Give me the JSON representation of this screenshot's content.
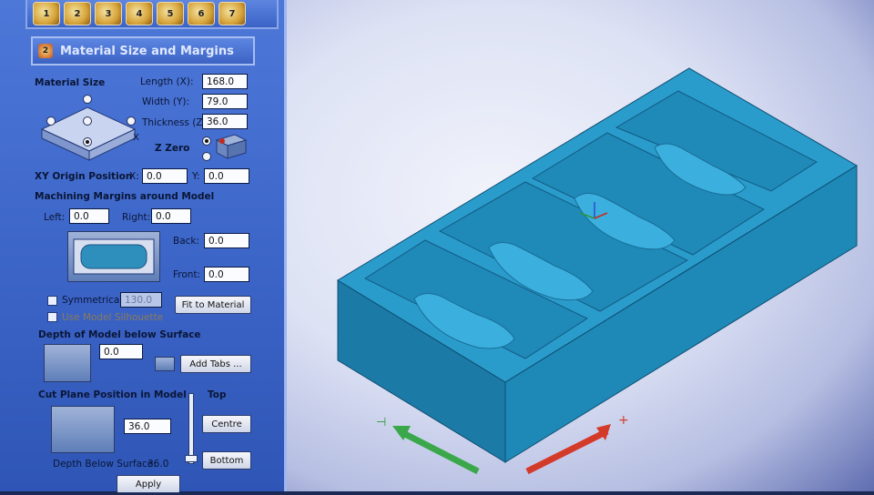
{
  "toolbar": {
    "buttons": [
      "1",
      "2",
      "3",
      "4",
      "5",
      "6",
      "7"
    ]
  },
  "panel": {
    "title": "Material Size and Margins",
    "material_size": {
      "heading": "Material Size",
      "length_label": "Length (X):",
      "length_value": "168.0",
      "width_label": "Width (Y):",
      "width_value": "79.0",
      "thickness_label": "Thickness (Z):",
      "thickness_value": "36.0",
      "zzero_label": "Z Zero"
    },
    "xy_origin": {
      "heading": "XY Origin Position",
      "x_label": "X:",
      "x_value": "0.0",
      "y_label": "Y:",
      "y_value": "0.0"
    },
    "margins": {
      "heading": "Machining Margins around Model",
      "left_label": "Left:",
      "left_value": "0.0",
      "right_label": "Right:",
      "right_value": "0.0",
      "back_label": "Back:",
      "back_value": "0.0",
      "front_label": "Front:",
      "front_value": "0.0",
      "symmetrical_label": "Symmetrical",
      "symmetrical_value": "130.0",
      "silhouette_label": "Use Model Silhouette",
      "fit_button": "Fit to Material"
    },
    "depth": {
      "heading": "Depth of Model below Surface",
      "value": "0.0",
      "add_tabs_button": "Add Tabs ..."
    },
    "cut_plane": {
      "heading": "Cut Plane Position in Model",
      "value": "36.0",
      "top_label": "Top",
      "centre_button": "Centre",
      "bottom_button": "Bottom",
      "depth_below_label": "Depth Below Surface:",
      "depth_below_value": "36.0"
    },
    "apply_button": "Apply"
  },
  "colors": {
    "panel_blue": "#3d66c9",
    "model_teal": "#1f8fb8",
    "x_axis_red": "#d43a2a",
    "y_axis_green": "#3aa84a"
  }
}
